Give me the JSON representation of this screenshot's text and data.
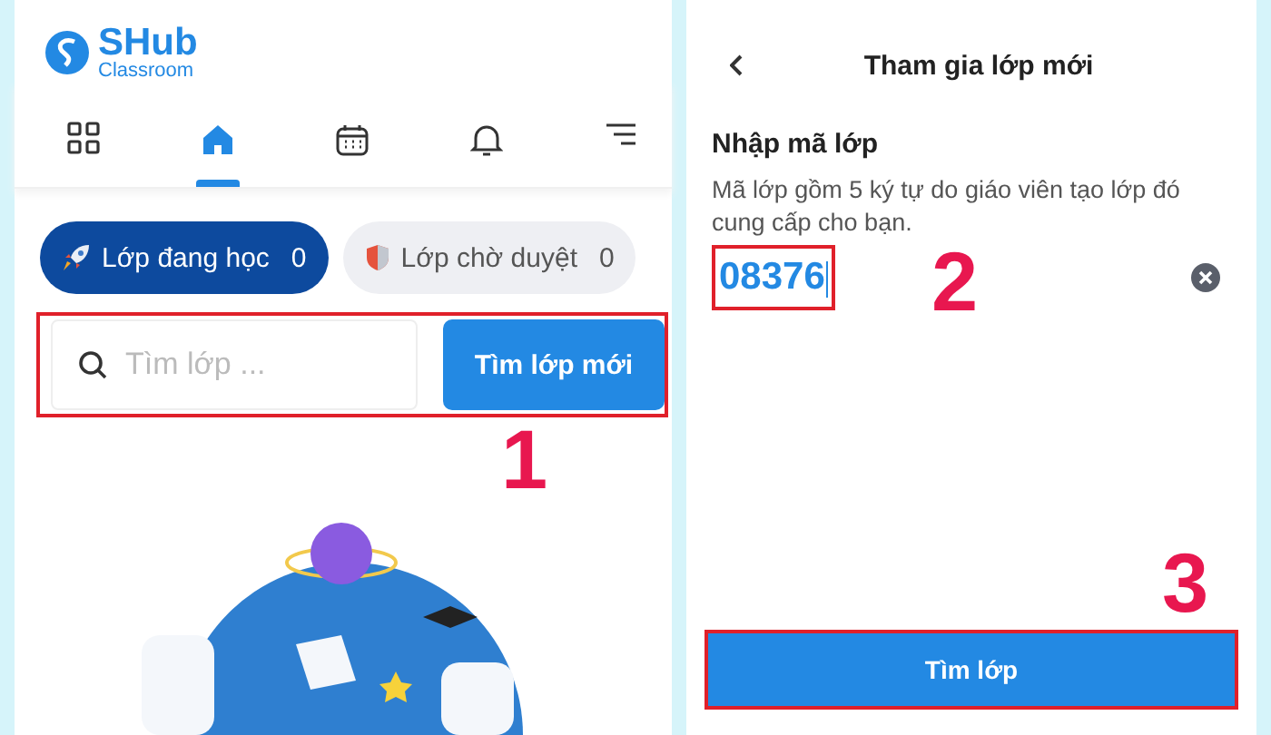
{
  "home_screen": {
    "logo": {
      "name": "SHub",
      "subtitle": "Classroom"
    },
    "nav": [
      {
        "kind": "grid",
        "selected": false
      },
      {
        "kind": "home",
        "selected": true
      },
      {
        "kind": "calendar",
        "selected": false
      },
      {
        "kind": "bell",
        "selected": false
      },
      {
        "kind": "menu",
        "selected": false
      }
    ],
    "class_tabs": [
      {
        "kind": "rocket",
        "label": "Lớp đang học",
        "count": "0",
        "selected": true
      },
      {
        "kind": "shield",
        "label": "Lớp chờ duyệt",
        "count": "0",
        "selected": false
      }
    ],
    "search": {
      "placeholder": "Tìm lớp ...",
      "button": "Tìm lớp mới",
      "highlighted": true
    },
    "step": "1"
  },
  "join_screen": {
    "title": "Tham gia lớp mới",
    "heading": "Nhập mã lớp",
    "description": "Mã lớp gồm 5 ký tự do giáo viên tạo lớp đó cung cấp cho bạn.",
    "code": {
      "value": "08376",
      "highlighted": true
    },
    "code_step": "2",
    "button": {
      "label": "Tìm lớp",
      "highlighted": true
    },
    "button_step": "3"
  }
}
